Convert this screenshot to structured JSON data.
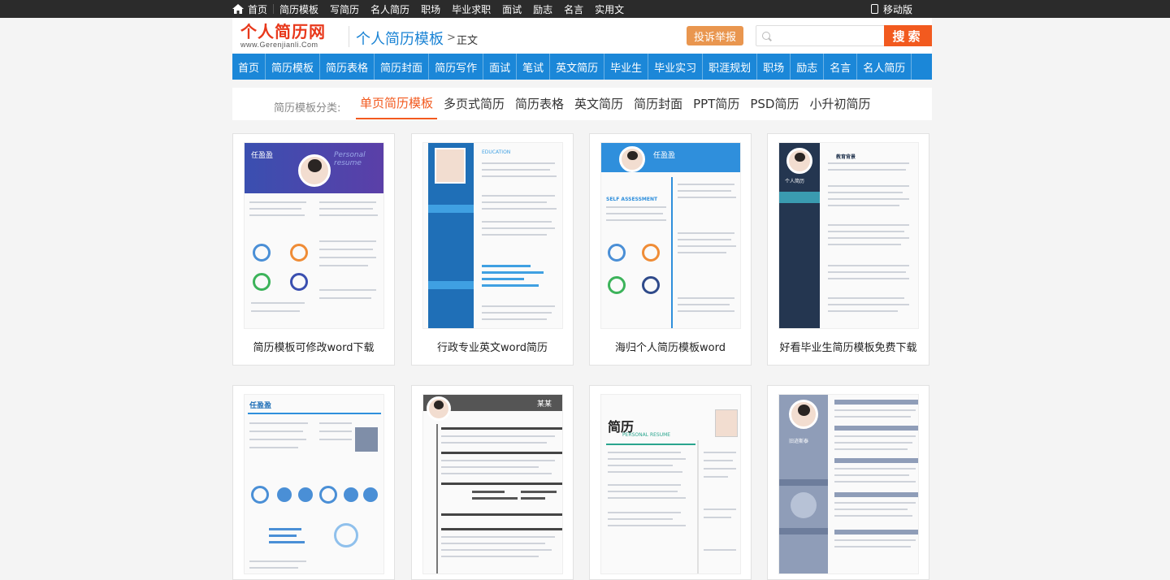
{
  "topbar": {
    "links": [
      "首页",
      "简历模板",
      "写简历",
      "名人简历",
      "职场",
      "毕业求职",
      "面试",
      "励志",
      "名言",
      "实用文"
    ],
    "mobile": "移动版"
  },
  "header": {
    "logo_title": "个人简历网",
    "logo_sub": "www.Gerenjianli.Com",
    "breadcrumb_section": "个人简历模板",
    "breadcrumb_separator": ">",
    "breadcrumb_current": "正文",
    "report_label": "投诉举报",
    "search_placeholder": "",
    "search_label": "搜索"
  },
  "nav": [
    "首页",
    "简历模板",
    "简历表格",
    "简历封面",
    "简历写作",
    "面试",
    "笔试",
    "英文简历",
    "毕业生",
    "毕业实习",
    "职涯规划",
    "职场",
    "励志",
    "名言",
    "名人简历"
  ],
  "categories": {
    "label": "简历模板分类:",
    "items": [
      "单页简历模板",
      "多页式简历",
      "简历表格",
      "英文简历",
      "简历封面",
      "PPT简历",
      "PSD简历",
      "小升初简历"
    ],
    "active_index": 0
  },
  "cards": [
    {
      "title": "简历模板可修改word下载",
      "thumb_name": "任盈盈",
      "thumb_text": "Personal resume"
    },
    {
      "title": "行政专业英文word简历",
      "thumb_name": "",
      "thumb_text": "EDUCATION"
    },
    {
      "title": "海归个人简历模板word",
      "thumb_name": "任盈盈",
      "thumb_text": "SELF ASSESSMENT"
    },
    {
      "title": "好看毕业生简历模板免费下载",
      "thumb_name": "个人简历",
      "thumb_text": "教育背景"
    },
    {
      "title": "",
      "thumb_name": "任盈盈",
      "thumb_text": ""
    },
    {
      "title": "",
      "thumb_name": "某某",
      "thumb_text": ""
    },
    {
      "title": "",
      "thumb_name": "简历",
      "thumb_text": "PERSONAL RESUME"
    },
    {
      "title": "",
      "thumb_name": "旧迹斯泰",
      "thumb_text": ""
    }
  ],
  "colors": {
    "nav_bg": "#1b87d8",
    "accent": "#f25a1f",
    "report_bg": "#e9964f",
    "topbar_bg": "#2b2b2b"
  }
}
